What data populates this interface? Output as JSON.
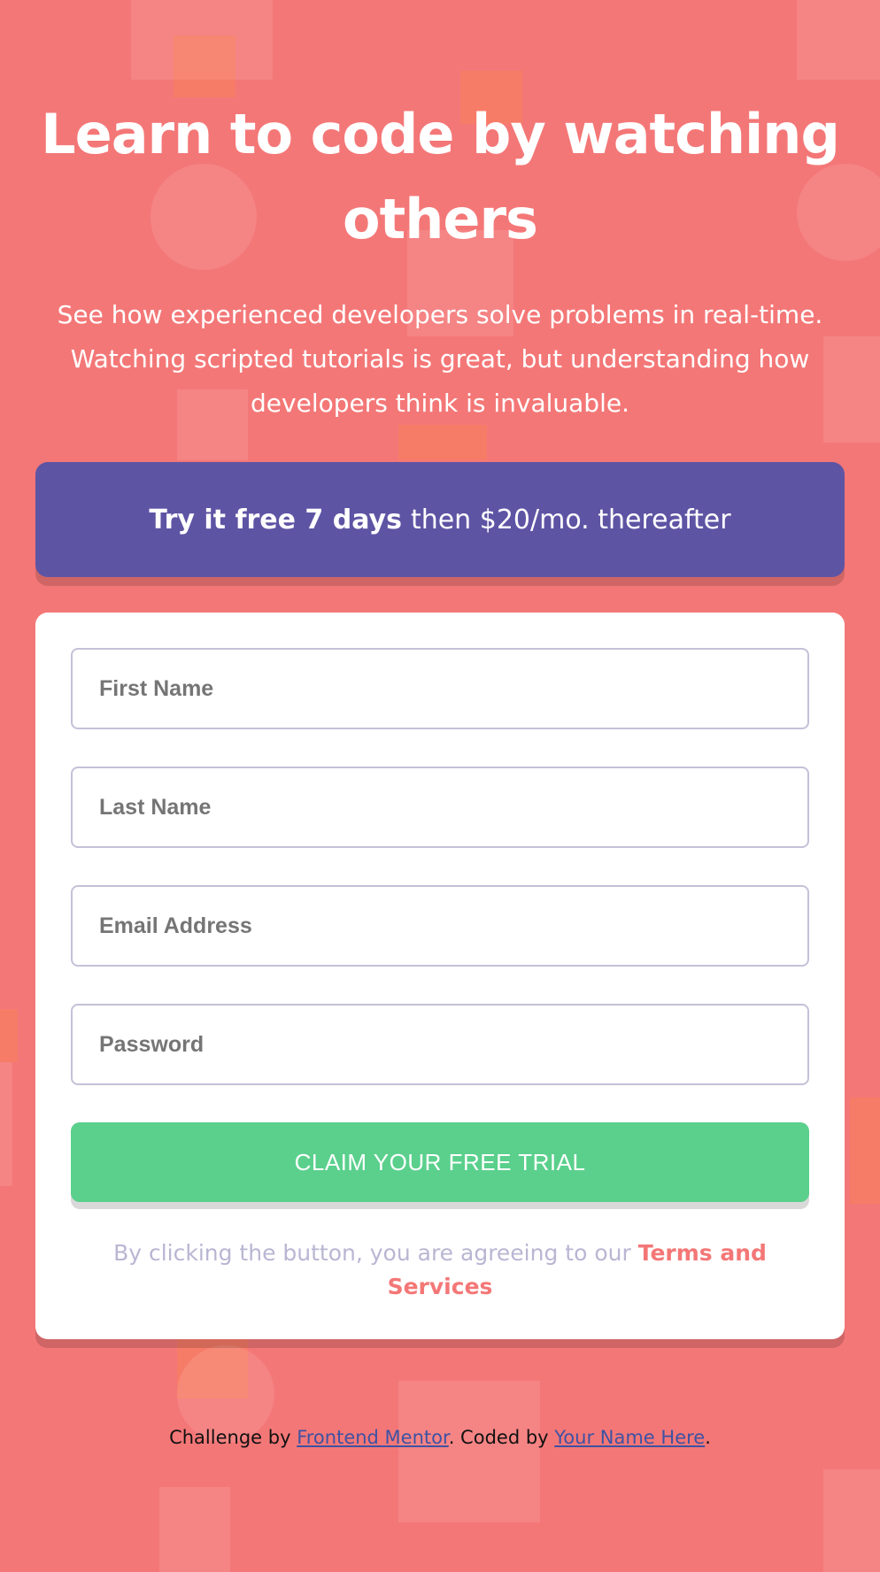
{
  "colors": {
    "background": "#f47777",
    "banner": "#5e54a4",
    "submit": "#5ad08c",
    "input_border": "#c4c1d8",
    "terms_muted": "#b9b6d3",
    "link": "#3e52a3"
  },
  "hero": {
    "title": "Learn to code by watching others",
    "description": "See how experienced developers solve problems in real-time. Watching scripted tutorials is great, but understanding how developers think is invaluable."
  },
  "promo": {
    "bold_text": "Try it free 7 days",
    "rest_text": "then $20/mo. thereafter"
  },
  "form": {
    "first_name_placeholder": "First Name",
    "last_name_placeholder": "Last Name",
    "email_placeholder": "Email Address",
    "password_placeholder": "Password",
    "submit_label": "CLAIM YOUR FREE TRIAL",
    "terms_prefix": "By clicking the button, you are agreeing to our",
    "terms_link": "Terms and Services"
  },
  "footer": {
    "prefix": "Challenge by",
    "link_1": "Frontend Mentor",
    "middle": ". Coded by",
    "link_2": "Your Name Here",
    "suffix": "."
  }
}
